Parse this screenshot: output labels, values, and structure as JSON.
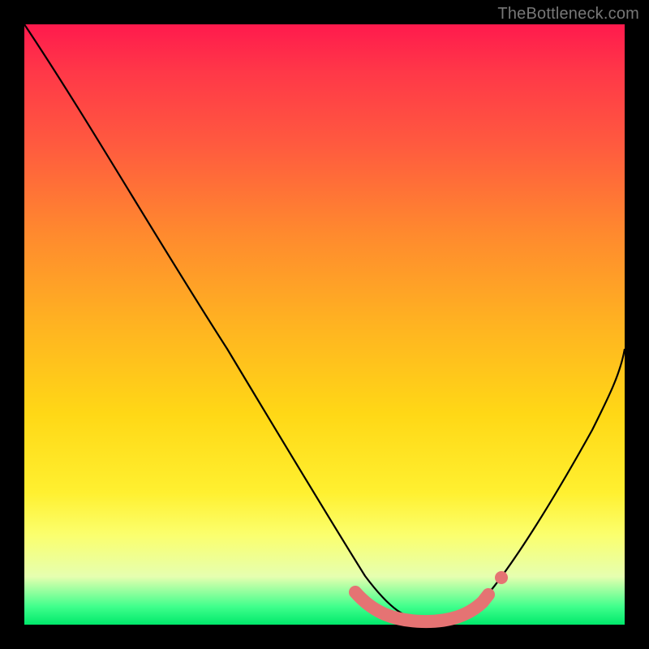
{
  "watermark": "TheBottleneck.com",
  "colors": {
    "background": "#000000",
    "gradient_top": "#ff1a4d",
    "gradient_bottom": "#00e86b",
    "curve": "#000000",
    "marker": "#e57373"
  },
  "chart_data": {
    "type": "line",
    "title": "",
    "xlabel": "",
    "ylabel": "",
    "xlim": [
      0,
      100
    ],
    "ylim": [
      0,
      100
    ],
    "series": [
      {
        "name": "bottleneck-curve",
        "x": [
          0,
          5,
          10,
          15,
          20,
          25,
          30,
          35,
          40,
          45,
          50,
          55,
          58,
          60,
          62,
          65,
          68,
          70,
          73,
          76,
          80,
          85,
          90,
          95,
          100
        ],
        "values": [
          100,
          93,
          86,
          79,
          71,
          63,
          55,
          47,
          39,
          31,
          23,
          14,
          8,
          4,
          2,
          1,
          0.5,
          0.5,
          1,
          3,
          8,
          16,
          25,
          35,
          46
        ]
      }
    ],
    "markers": {
      "name": "highlight-band",
      "x": [
        55,
        57,
        59,
        61,
        63,
        65,
        67,
        69,
        71,
        73,
        75,
        76,
        77
      ],
      "values": [
        2,
        1.5,
        1,
        0.8,
        0.6,
        0.5,
        0.5,
        0.6,
        0.8,
        1,
        1.6,
        2.2,
        3
      ]
    }
  }
}
